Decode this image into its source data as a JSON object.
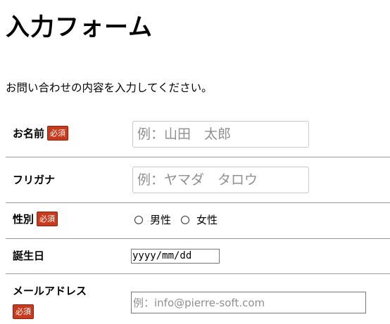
{
  "page": {
    "title": "入力フォーム",
    "intro": "お問い合わせの内容を入力してください。"
  },
  "form": {
    "required_badge": "必須",
    "name": {
      "label": "お名前",
      "placeholder": "例：山田　太郎",
      "value": ""
    },
    "furigana": {
      "label": "フリガナ",
      "placeholder": "例：ヤマダ　タロウ",
      "value": ""
    },
    "gender": {
      "label": "性別",
      "options": [
        "男性",
        "女性"
      ],
      "selected": null
    },
    "birthday": {
      "label": "誕生日",
      "format": "yyyy/mm/dd",
      "value": ""
    },
    "email": {
      "label": "メールアドレス",
      "placeholder": "例：info@pierre-soft.com",
      "value": ""
    }
  },
  "colors": {
    "badge": "#c63a1d",
    "separator": "#9a9a9a",
    "input_border": "#c9c9c9",
    "placeholder": "#8f8f8f"
  }
}
